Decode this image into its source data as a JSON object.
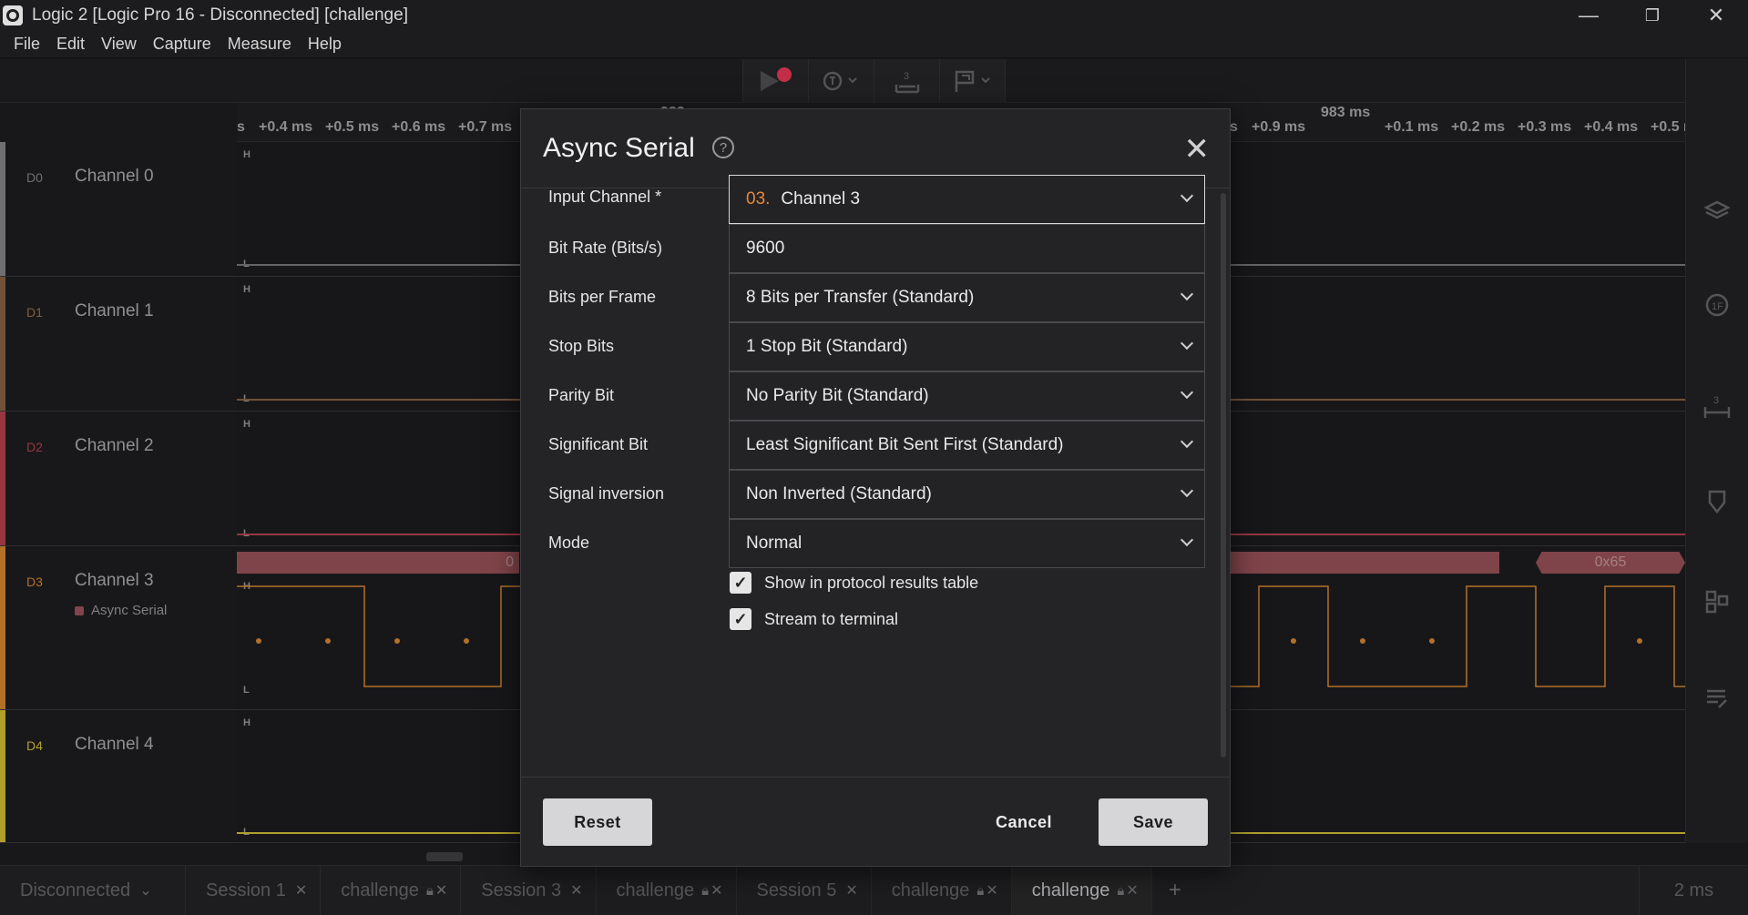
{
  "window": {
    "title": "Logic 2 [Logic Pro 16 - Disconnected] [challenge]",
    "controls": {
      "minimize": "—",
      "restore": "❐",
      "close": "✕"
    }
  },
  "menu": [
    "File",
    "Edit",
    "View",
    "Capture",
    "Measure",
    "Help"
  ],
  "ruler": {
    "left_ticks": [
      "s",
      "+0.4 ms",
      "+0.5 ms",
      "+0.6 ms",
      "+0.7 ms"
    ],
    "right_ticks": [
      "s",
      "+0.9 ms",
      "+0.1 ms",
      "+0.2 ms",
      "+0.3 ms",
      "+0.4 ms",
      "+0.5 r"
    ],
    "major_label": "983 ms",
    "major_label_partial": "982"
  },
  "channels": [
    {
      "id": "D0",
      "name": "Channel 0",
      "color": "#7a7a7c"
    },
    {
      "id": "D1",
      "name": "Channel 1",
      "color": "#7c5a3e"
    },
    {
      "id": "D2",
      "name": "Channel 2",
      "color": "#a33b46"
    },
    {
      "id": "D3",
      "name": "Channel 3",
      "color": "#c27a2c",
      "analyzer": "Async Serial"
    },
    {
      "id": "D4",
      "name": "Channel 4",
      "color": "#bfae2f"
    }
  ],
  "waveform": {
    "high_label": "H",
    "low_label": "L",
    "protocol_values": [
      "0",
      "0x65"
    ]
  },
  "dialog": {
    "title": "Async Serial",
    "help_glyph": "?",
    "close_glyph": "✕",
    "fields": [
      {
        "label": "Input Channel *",
        "prefix": "03.",
        "value": "Channel 3",
        "dropdown": true
      },
      {
        "label": "Bit Rate (Bits/s)",
        "value": "9600",
        "dropdown": false
      },
      {
        "label": "Bits per Frame",
        "value": "8 Bits per Transfer (Standard)",
        "dropdown": true
      },
      {
        "label": "Stop Bits",
        "value": "1 Stop Bit (Standard)",
        "dropdown": true
      },
      {
        "label": "Parity Bit",
        "value": "No Parity Bit (Standard)",
        "dropdown": true
      },
      {
        "label": "Significant Bit",
        "value": "Least Significant Bit Sent First (Standard)",
        "dropdown": true
      },
      {
        "label": "Signal inversion",
        "value": "Non Inverted (Standard)",
        "dropdown": true
      },
      {
        "label": "Mode",
        "value": "Normal",
        "dropdown": true
      }
    ],
    "checkboxes": [
      {
        "label": "Show in protocol results table",
        "checked": true
      },
      {
        "label": "Stream to terminal",
        "checked": true
      }
    ],
    "buttons": {
      "reset": "Reset",
      "cancel": "Cancel",
      "save": "Save"
    }
  },
  "tabs": [
    {
      "label": "Disconnected",
      "kind": "device"
    },
    {
      "label": "Session 1",
      "locked": false
    },
    {
      "label": "challenge",
      "locked": true
    },
    {
      "label": "Session 3",
      "locked": false
    },
    {
      "label": "challenge",
      "locked": true
    },
    {
      "label": "Session 5",
      "locked": false
    },
    {
      "label": "challenge",
      "locked": true
    },
    {
      "label": "challenge",
      "locked": true,
      "active": true
    }
  ],
  "tab_add": "+",
  "zoom": "2 ms",
  "colors": {
    "accent_orange": "#e3893b",
    "record_red": "#d4344f",
    "protocol_bar": "#8a4a50"
  }
}
